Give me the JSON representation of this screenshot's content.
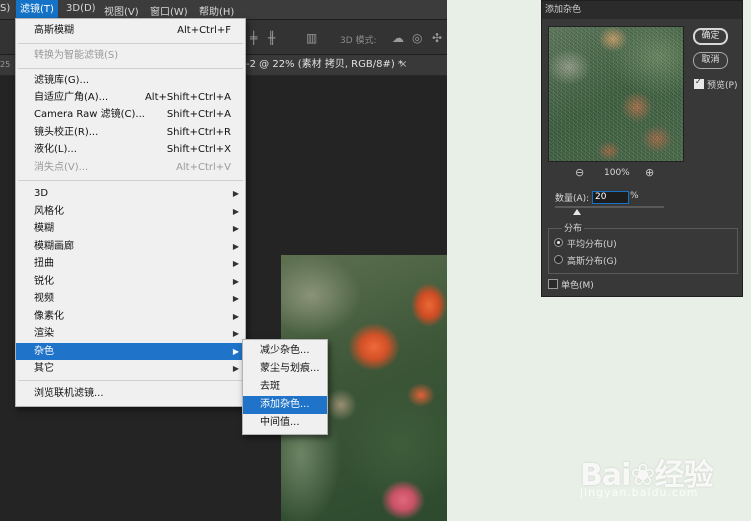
{
  "menubar": {
    "items": [
      {
        "label": "S)"
      },
      {
        "label": "滤镜(T)"
      },
      {
        "label": "3D(D)"
      },
      {
        "label": "视图(V)"
      },
      {
        "label": "窗口(W)"
      },
      {
        "label": "帮助(H)"
      }
    ]
  },
  "options_bar": {
    "mode_3d": "3D 模式:"
  },
  "document": {
    "tab_title": "-2 @ 22% (素材 拷贝, RGB/8#) *",
    "close": "×",
    "ruler_left": "25"
  },
  "filter_menu": {
    "last_filter": {
      "label": "高斯模糊",
      "shortcut": "Alt+Ctrl+F"
    },
    "convert_smart": {
      "label": "转换为智能滤镜(S)"
    },
    "group1": [
      {
        "label": "滤镜库(G)...",
        "shortcut": ""
      },
      {
        "label": "自适应广角(A)...",
        "shortcut": "Alt+Shift+Ctrl+A"
      },
      {
        "label": "Camera Raw 滤镜(C)...",
        "shortcut": "Shift+Ctrl+A"
      },
      {
        "label": "镜头校正(R)...",
        "shortcut": "Shift+Ctrl+R"
      },
      {
        "label": "液化(L)...",
        "shortcut": "Shift+Ctrl+X"
      },
      {
        "label": "消失点(V)...",
        "shortcut": "Alt+Ctrl+V"
      }
    ],
    "group2": [
      {
        "label": "3D"
      },
      {
        "label": "风格化"
      },
      {
        "label": "模糊"
      },
      {
        "label": "模糊画廊"
      },
      {
        "label": "扭曲"
      },
      {
        "label": "锐化"
      },
      {
        "label": "视频"
      },
      {
        "label": "像素化"
      },
      {
        "label": "渲染"
      },
      {
        "label": "杂色"
      },
      {
        "label": "其它"
      }
    ],
    "browse_online": {
      "label": "浏览联机滤镜..."
    }
  },
  "noise_submenu": {
    "items": [
      {
        "label": "减少杂色..."
      },
      {
        "label": "蒙尘与划痕..."
      },
      {
        "label": "去斑"
      },
      {
        "label": "添加杂色..."
      },
      {
        "label": "中间值..."
      }
    ]
  },
  "add_noise_dialog": {
    "title": "添加杂色",
    "ok_label": "确定",
    "cancel_label": "取消",
    "preview_label": "预览(P)",
    "preview_checked": true,
    "zoom_out_icon": "zoom-out-icon",
    "zoom_level": "100%",
    "zoom_in_icon": "zoom-in-icon",
    "amount_label": "数量(A):",
    "amount_value": "20",
    "amount_unit": "%",
    "amount_slider_fraction": 0.2,
    "distribution_title": "分布",
    "distribution_options": [
      {
        "label": "平均分布(U)",
        "selected": true
      },
      {
        "label": "高斯分布(G)",
        "selected": false
      }
    ],
    "monochromatic_label": "单色(M)",
    "monochromatic_checked": false
  },
  "watermark": {
    "logo": "Bai❀经验",
    "url": "jingyan.baidu.com"
  },
  "colors": {
    "menu_highlight": "#1f73c8",
    "menu_bg": "#f0f0f0",
    "dialog_bg": "#383838",
    "page_bg": "#e8efe6"
  }
}
